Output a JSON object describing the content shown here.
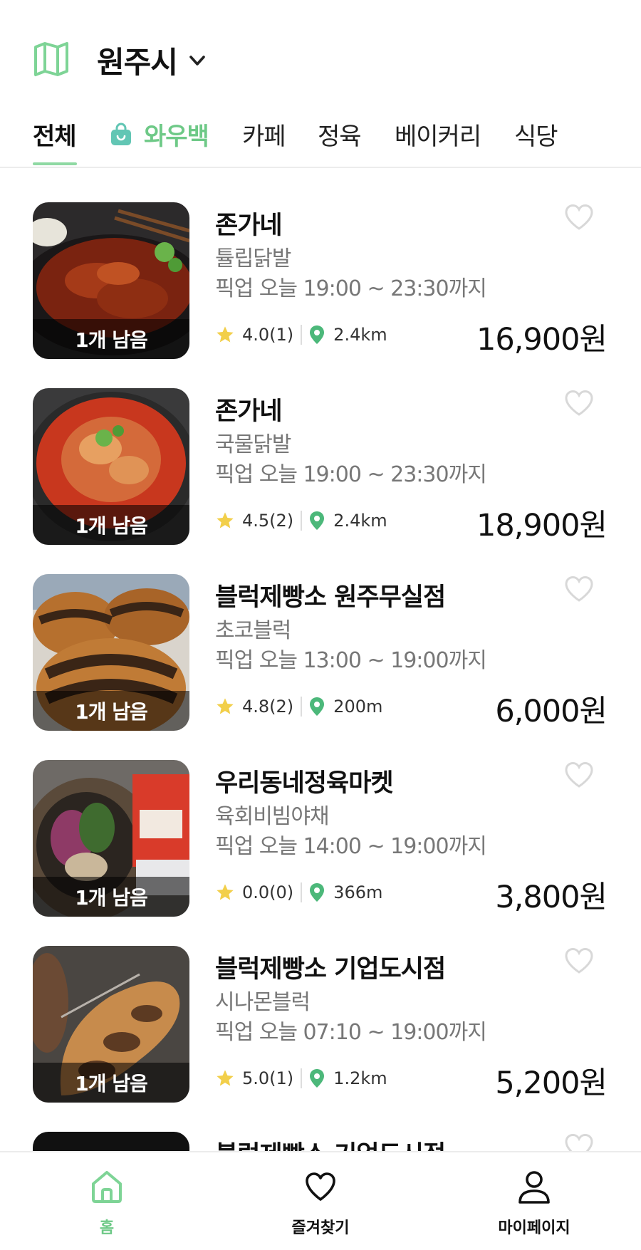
{
  "header": {
    "city": "원주시",
    "map_icon": "map-icon",
    "dropdown_icon": "chevron-down-icon"
  },
  "tabs": [
    {
      "label": "전체",
      "active": true
    },
    {
      "label": "와우백",
      "icon": "shopping-bag-icon"
    },
    {
      "label": "카페"
    },
    {
      "label": "정육"
    },
    {
      "label": "베이커리"
    },
    {
      "label": "식당"
    }
  ],
  "items": [
    {
      "store": "존가네",
      "product": "튤립닭발",
      "pickup": "픽업 오늘 19:00 ~ 23:30까지",
      "rating": "4.0(1)",
      "distance": "2.4km",
      "price": "16,900원",
      "remaining": "1개 남음"
    },
    {
      "store": "존가네",
      "product": "국물닭발",
      "pickup": "픽업 오늘 19:00 ~ 23:30까지",
      "rating": "4.5(2)",
      "distance": "2.4km",
      "price": "18,900원",
      "remaining": "1개 남음"
    },
    {
      "store": "블럭제빵소 원주무실점",
      "product": "초코블럭",
      "pickup": "픽업 오늘 13:00 ~ 19:00까지",
      "rating": "4.8(2)",
      "distance": "200m",
      "price": "6,000원",
      "remaining": "1개 남음"
    },
    {
      "store": "우리동네정육마켓",
      "product": "육회비빔야채",
      "pickup": "픽업 오늘 14:00 ~ 19:00까지",
      "rating": "0.0(0)",
      "distance": "366m",
      "price": "3,800원",
      "remaining": "1개 남음"
    },
    {
      "store": "블럭제빵소 기업도시점",
      "product": "시나몬블럭",
      "pickup": "픽업 오늘 07:10 ~ 19:00까지",
      "rating": "5.0(1)",
      "distance": "1.2km",
      "price": "5,200원",
      "remaining": "1개 남음"
    },
    {
      "store": "블럭제빵소 기업도시점"
    }
  ],
  "bottom_nav": [
    {
      "label": "홈",
      "icon": "home-icon",
      "active": true
    },
    {
      "label": "즐겨찾기",
      "icon": "heart-icon"
    },
    {
      "label": "마이페이지",
      "icon": "user-icon"
    }
  ],
  "colors": {
    "accent": "#6ec987",
    "star": "#f2cf4a",
    "pin": "#4cb87a",
    "badge_overlay": "rgba(0,0,0,0.55)"
  }
}
